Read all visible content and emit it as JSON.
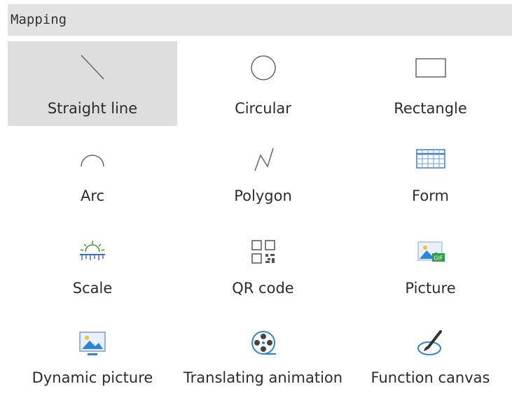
{
  "header": {
    "title": "Mapping"
  },
  "tools": [
    {
      "label": "Straight line",
      "icon": "straight-line-icon"
    },
    {
      "label": "Circular",
      "icon": "circle-icon"
    },
    {
      "label": "Rectangle",
      "icon": "rectangle-icon"
    },
    {
      "label": "Arc",
      "icon": "arc-icon"
    },
    {
      "label": "Polygon",
      "icon": "polygon-icon"
    },
    {
      "label": "Form",
      "icon": "table-grid-icon"
    },
    {
      "label": "Scale",
      "icon": "scale-icon"
    },
    {
      "label": "QR code",
      "icon": "qr-code-icon"
    },
    {
      "label": "Picture",
      "icon": "picture-gif-icon"
    },
    {
      "label": "Dynamic picture",
      "icon": "dynamic-picture-icon"
    },
    {
      "label": "Translating animation",
      "icon": "film-reel-icon"
    },
    {
      "label": "Function canvas",
      "icon": "paint-brush-icon"
    }
  ],
  "selected_tool": "Straight line"
}
